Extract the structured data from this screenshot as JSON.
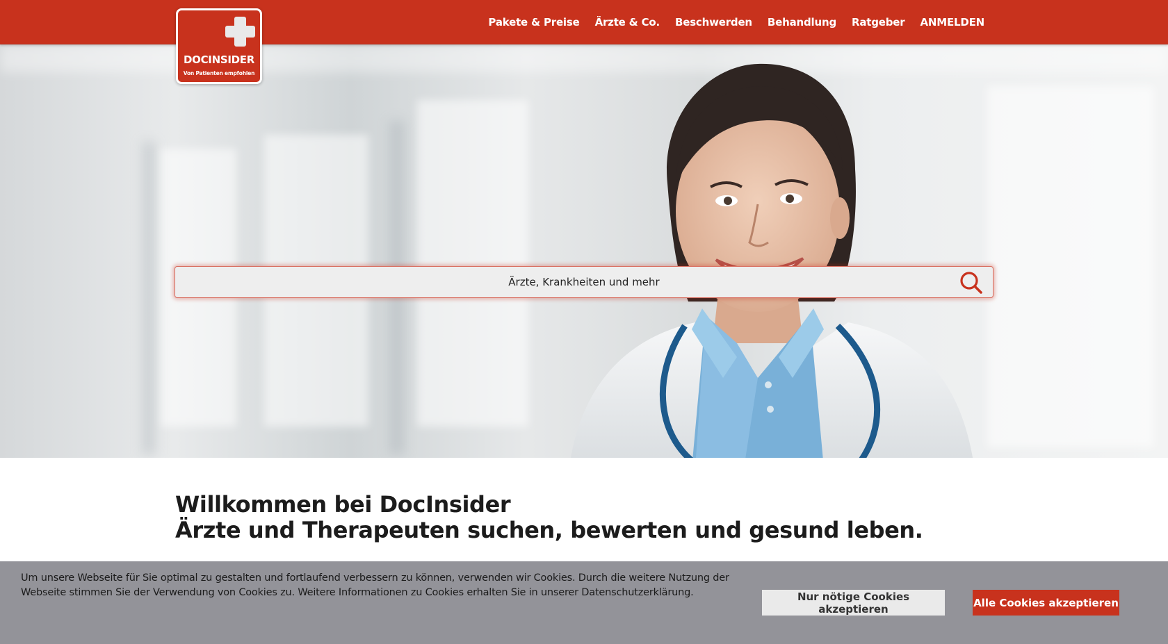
{
  "brand": {
    "name": "DOCINSIDER",
    "tagline": "Von Patienten empfohlen",
    "color": "#c8321d"
  },
  "nav": {
    "items": [
      {
        "label": "Pakete & Preise"
      },
      {
        "label": "Ärzte & Co."
      },
      {
        "label": "Beschwerden"
      },
      {
        "label": "Behandlung"
      },
      {
        "label": "Ratgeber"
      },
      {
        "label": "ANMELDEN"
      }
    ]
  },
  "search": {
    "placeholder": "Ärzte, Krankheiten und mehr",
    "icon": "search-icon"
  },
  "welcome": {
    "line1": "Willkommen bei DocInsider",
    "line2": "Ärzte und Therapeuten suchen, bewerten und gesund leben."
  },
  "cookie": {
    "text": "Um unsere Webseite für Sie optimal zu gestalten und fortlaufend verbessern zu können, verwenden wir Cookies. Durch die weitere Nutzung der Webseite stimmen Sie der Verwendung von Cookies zu. Weitere Informationen zu Cookies erhalten Sie in unserer ",
    "link": "Datenschutzerklärung",
    "suffix": ".",
    "btn_necessary": "Nur nötige Cookies akzeptieren",
    "btn_all": "Alle Cookies akzeptieren"
  }
}
